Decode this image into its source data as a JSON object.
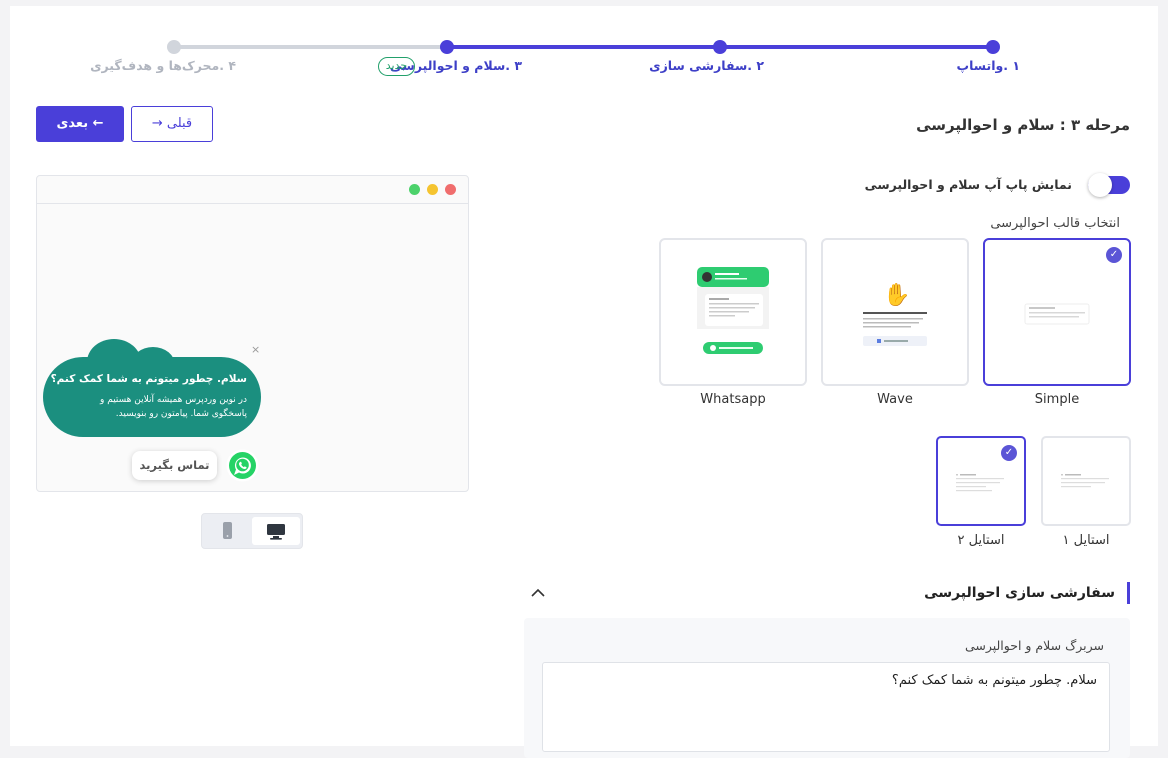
{
  "stepper": {
    "steps": [
      {
        "label": "۱ .واتساپ",
        "state": "done"
      },
      {
        "label": "۲ .سفارشی سازی",
        "state": "done"
      },
      {
        "label": "۳ .سلام و احوالپرسی",
        "state": "current",
        "badge": "جدید"
      },
      {
        "label": "۴ .محرک‌ها و هدف‌گیری",
        "state": "todo"
      }
    ],
    "colors": {
      "active": "#4a3fd9",
      "inactive": "#d1d5dc"
    }
  },
  "nav": {
    "next_label": "بعدی ←",
    "prev_label": "→ قبلی"
  },
  "page_title": "مرحله ۳ : سلام و احوالپرسی",
  "preview": {
    "bubble_title": "سلام. چطور میتونم به شما کمک کنم؟",
    "bubble_text": "در نوین وردپرس همیشه آنلاین هستیم و پاسخگوی شما. پیامتون رو بنویسید.",
    "close_glyph": "×",
    "contact_label": "تماس بگیرید",
    "window_dots": [
      "#f06d6d",
      "#f5c430",
      "#4cd26b"
    ],
    "bubble_color": "#1b8f7f",
    "whatsapp_color": "#25d366"
  },
  "device_toggle": {
    "desktop_icon": "desktop-icon",
    "mobile_icon": "mobile-icon",
    "selected": "desktop"
  },
  "settings": {
    "popup_toggle_label": "نمایش پاپ آپ سلام و احوالپرسی",
    "popup_toggle_on": true,
    "template_section_label": "انتخاب قالب احوالپرسی",
    "templates": [
      {
        "name": "Simple",
        "selected": true
      },
      {
        "name": "Wave",
        "selected": false
      },
      {
        "name": "Whatsapp",
        "selected": false
      }
    ],
    "styles": [
      {
        "name": "استایل ۱",
        "selected": false
      },
      {
        "name": "استایل ۲",
        "selected": true
      }
    ],
    "customize_heading": "سفارشی سازی احوالپرسی",
    "greeting_title_label": "سربرگ سلام و احوالپرسی",
    "greeting_title_value": "سلام. چطور میتونم به شما کمک کنم؟"
  }
}
